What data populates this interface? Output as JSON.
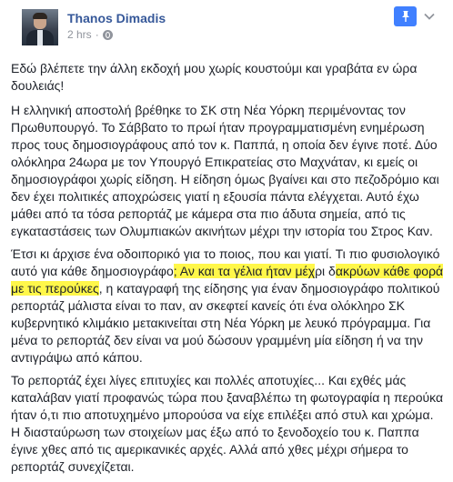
{
  "post": {
    "author": "Thanos Dimadis",
    "time": "2 hrs",
    "dot": "·",
    "privacy_icon": "globe-icon",
    "pin_icon": "pin-icon",
    "menu_icon": "chevron-down-icon",
    "colors": {
      "name": "#365899",
      "pin": "#4080ff",
      "highlight": "#fff74a"
    }
  },
  "content": {
    "p1": "Εδώ βλέπετε την άλλη εκδοχή μου χωρίς κουστούμι και γραβάτα εν ώρα δουλειάς!",
    "p2": "Η ελληνική αποστολή βρέθηκε το ΣΚ στη Νέα Υόρκη περιμένοντας τον Πρωθυπουργό. Το Σάββατο το πρωί ήταν προγραμματισμένη ενημέρωση προς τους δημοσιογράφους από τον κ. Παππά, η οποία δεν έγινε ποτέ. Δύο ολόκληρα 24ωρα με τον Υπουργό Επικρατείας στο Μαχνάταν, κι εμείς οι δημοσιογράφοι χωρίς είδηση. Η είδηση όμως βγαίνει και στο πεζοδρόμιο και δεν έχει πολιτικές αποχρώσεις γιατί η εξουσία πάντα ελέγχεται. Αυτό έχω μάθει από τα τόσα ρεπορτάζ με κάμερα στα πιο άδυτα σημεία, από τις εγκαταστάσεις των Ολυμπιακών ακινήτων μέχρι την ιστορία του Στρος Καν.",
    "p3_a": "Έτσι κι άρχισε ένα οδοιπορικό για το ποιος, που και γιατί. Τι πιο φυσιολογικό αυτό για κάθε δημοσιογράφο",
    "p3_hl1": "; Αν και τα γέλια ήταν μέχ",
    "p3_b": "ρι δ",
    "p3_hl2": "ακρύων κάθε φορά με τις περούκες",
    "p3_c": ", η καταγραφή της είδησης για έναν δημοσιογράφο πολιτικού ρεπορτάζ μάλιστα είναι το παν, αν σκεφτεί κανείς ότι ένα ολόκληρο ΣΚ κυβερνητικό κλιμάκιο μετακινείται στη Νέα Υόρκη με λευκό πρόγραμμα. Για μένα το ρεπορτάζ δεν είναι να μού δώσουν γραμμένη μία είδηση ή να την αντιγράψω από κάπου.",
    "p4": "Το ρεπορτάζ έχει λίγες επιτυχίες και πολλές αποτυχίες... Και εχθές μάς καταλάβαν γιατί προφανώς τώρα που ξαναβλέπω τη φωτογραφία η περούκα ήταν ό,τι πιο αποτυχημένο μπορούσα να είχε επιλέξει από στυλ και χρώμα. Η διασταύρωση των στοιχείων μας έξω από το ξενοδοχείο του κ. Παππα έγινε χθες από τις αμερικανικές αρχές. Αλλά από χθες μέχρι σήμερα το ρεπορτάζ συνεχίζεται."
  }
}
